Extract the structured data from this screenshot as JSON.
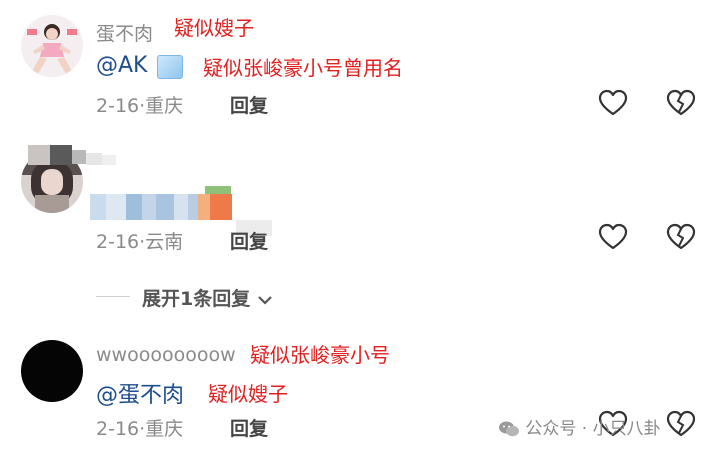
{
  "comments": [
    {
      "username": "蛋不肉",
      "username_note": "疑似嫂子",
      "mention": "@AK",
      "mention_note": "疑似张峻豪小号曾用名",
      "date": "2-16",
      "location": "重庆",
      "reply_label": "回复"
    },
    {
      "username": "",
      "date": "2-16",
      "location": "云南",
      "reply_label": "回复"
    },
    {
      "username": "wwoooooooow",
      "username_note": "疑似张峻豪小号",
      "mention": "@蛋不肉",
      "mention_note": "疑似嫂子",
      "date": "2-16",
      "location": "重庆",
      "reply_label": "回复"
    }
  ],
  "expand": {
    "label": "展开1条回复"
  },
  "watermark": {
    "text": "公众号 · 小只八卦"
  },
  "colors": {
    "annotation": "#e0201f",
    "mention": "#1f4e8c",
    "meta": "#8a8a8a"
  }
}
